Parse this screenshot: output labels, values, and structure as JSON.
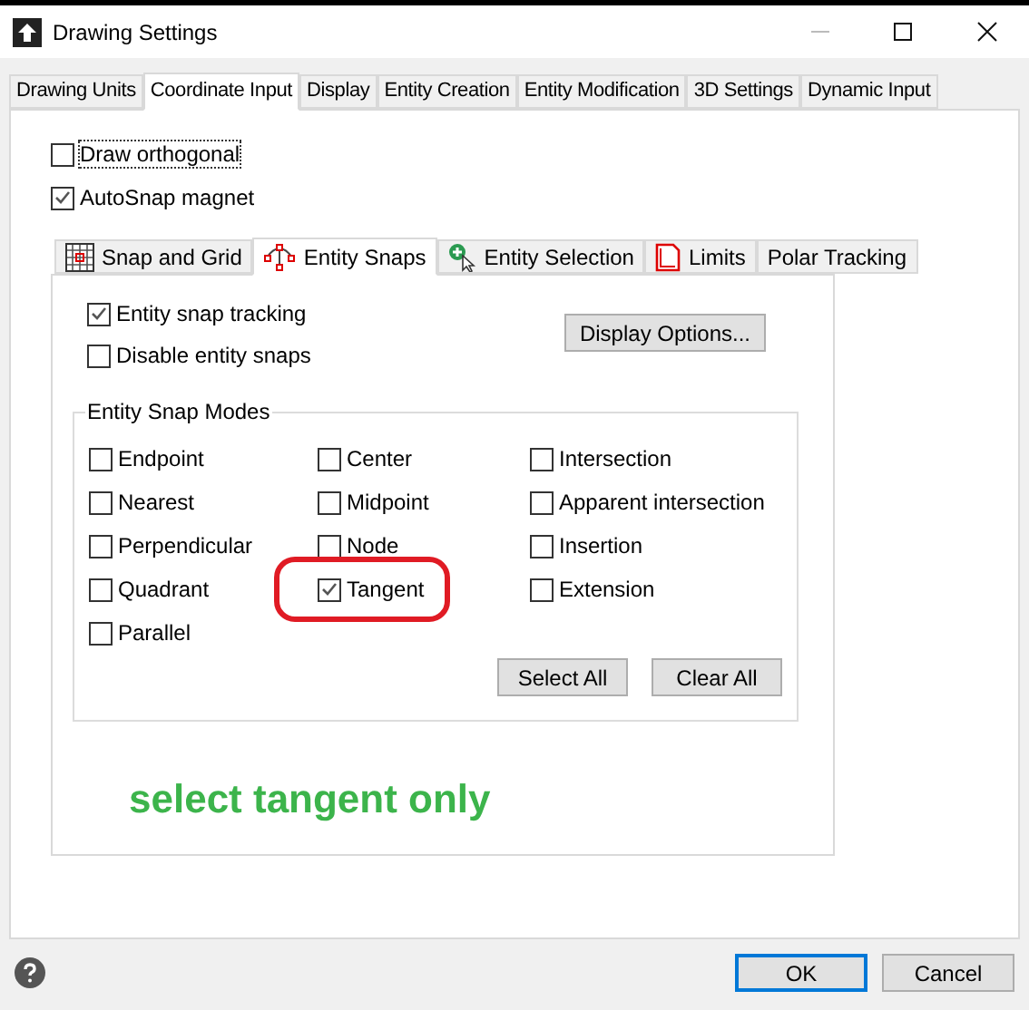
{
  "window": {
    "title": "Drawing Settings"
  },
  "tabs": [
    {
      "label": "Drawing Units",
      "selected": false
    },
    {
      "label": "Coordinate Input",
      "selected": true
    },
    {
      "label": "Display",
      "selected": false
    },
    {
      "label": "Entity Creation",
      "selected": false
    },
    {
      "label": "Entity Modification",
      "selected": false
    },
    {
      "label": "3D Settings",
      "selected": false
    },
    {
      "label": "Dynamic Input",
      "selected": false
    }
  ],
  "options": [
    {
      "label": "Draw orthogonal",
      "checked": false,
      "focused": true
    },
    {
      "label": "AutoSnap magnet",
      "checked": true,
      "focused": false
    }
  ],
  "inner_tabs": [
    {
      "label": "Snap and Grid",
      "selected": false
    },
    {
      "label": "Entity Snaps",
      "selected": true
    },
    {
      "label": "Entity Selection",
      "selected": false
    },
    {
      "label": "Limits",
      "selected": false
    },
    {
      "label": "Polar Tracking",
      "selected": false
    }
  ],
  "snap_options": [
    {
      "label": "Entity snap tracking",
      "checked": true
    },
    {
      "label": "Disable entity snaps",
      "checked": false
    }
  ],
  "display_options_button": "Display Options...",
  "snap_modes": {
    "title": "Entity Snap Modes",
    "items": [
      {
        "label": "Endpoint",
        "checked": false,
        "circled": false
      },
      {
        "label": "Center",
        "checked": false,
        "circled": false
      },
      {
        "label": "Intersection",
        "checked": false,
        "circled": false
      },
      {
        "label": "Nearest",
        "checked": false,
        "circled": false
      },
      {
        "label": "Midpoint",
        "checked": false,
        "circled": false
      },
      {
        "label": "Apparent intersection",
        "checked": false,
        "circled": false
      },
      {
        "label": "Perpendicular",
        "checked": false,
        "circled": false
      },
      {
        "label": "Node",
        "checked": false,
        "circled": false
      },
      {
        "label": "Insertion",
        "checked": false,
        "circled": false
      },
      {
        "label": "Quadrant",
        "checked": false,
        "circled": false
      },
      {
        "label": "Tangent",
        "checked": true,
        "circled": true
      },
      {
        "label": "Extension",
        "checked": false,
        "circled": false
      },
      {
        "label": "Parallel",
        "checked": false,
        "circled": false
      }
    ],
    "buttons": [
      "Select All",
      "Clear All"
    ]
  },
  "annotation": "select tangent only",
  "footer_buttons": [
    {
      "label": "OK",
      "default": true
    },
    {
      "label": "Cancel",
      "default": false
    }
  ]
}
